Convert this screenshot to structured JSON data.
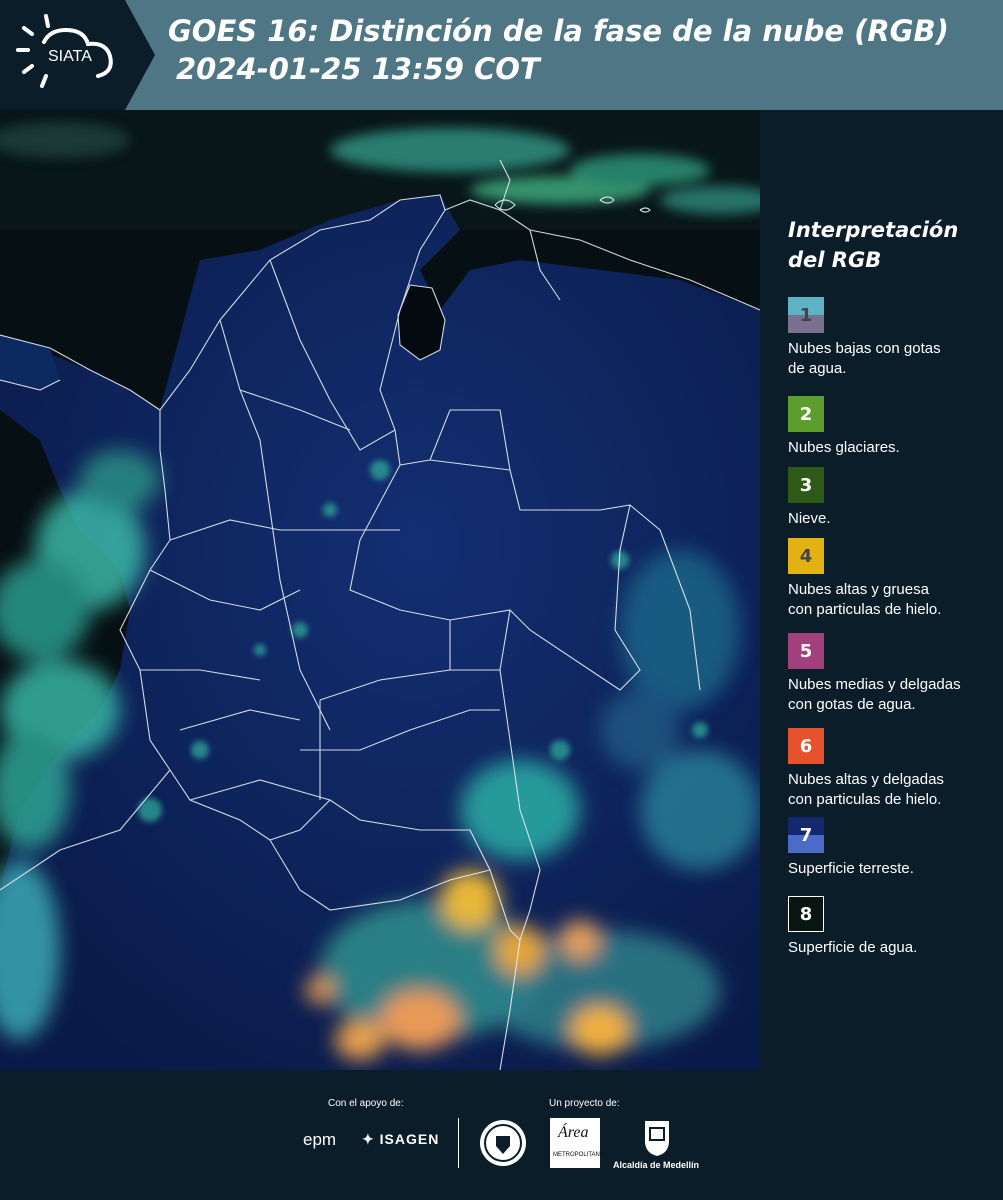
{
  "header": {
    "logo_text": "SIATA",
    "title_line1": "GOES 16: Distinción de la fase de la nube (RGB)",
    "title_line2": "2024-01-25 13:59 COT"
  },
  "map": {
    "icon": "satellite-rgb-map",
    "description_color_land": "#0e2a63",
    "description_color_water": "#06111a"
  },
  "legend": {
    "title_line1": "Interpretación",
    "title_line2": "del RGB",
    "items": [
      {
        "num": "1",
        "text_line1": "Nubes bajas con gotas",
        "text_line2": "de agua.",
        "color_top": "#5cb3c3",
        "color_bottom": "#7a7090",
        "num_color": "#444444"
      },
      {
        "num": "2",
        "text_line1": "Nubes glaciares.",
        "text_line2": "",
        "color_top": "#5c9e2c",
        "color_bottom": "#5c9e2c",
        "num_color": "#ffffff"
      },
      {
        "num": "3",
        "text_line1": "Nieve.",
        "text_line2": "",
        "color_top": "#2e5a17",
        "color_bottom": "#2e5a17",
        "num_color": "#ffffff"
      },
      {
        "num": "4",
        "text_line1": "Nubes altas y gruesa",
        "text_line2": "con particulas de hielo.",
        "color_top": "#e2b212",
        "color_bottom": "#e2b212",
        "num_color": "#444444"
      },
      {
        "num": "5",
        "text_line1": "Nubes medias y delgadas",
        "text_line2": "con gotas de agua.",
        "color_top": "#a2407c",
        "color_bottom": "#a2407c",
        "num_color": "#ffffff"
      },
      {
        "num": "6",
        "text_line1": "Nubes altas y delgadas",
        "text_line2": "con particulas de hielo.",
        "color_top": "#e5512a",
        "color_bottom": "#e5512a",
        "num_color": "#ffffff"
      },
      {
        "num": "7",
        "text_line1": "Superficie terreste.",
        "text_line2": "",
        "color_top": "#15286d",
        "color_bottom": "#4a6bc8",
        "num_color": "#ffffff"
      },
      {
        "num": "8",
        "text_line1": "Superficie de agua.",
        "text_line2": "",
        "color_top": "#081510",
        "color_bottom": "#081510",
        "num_color": "#ffffff"
      }
    ]
  },
  "footer": {
    "support_label": "Con el apoyo de:",
    "project_label": "Un proyecto de:",
    "sponsor1": "epm",
    "sponsor2": "ISAGEN",
    "amva_text": "Área",
    "amva_sub": "METROPOLITANA",
    "medellin": "Alcaldía de Medellín"
  }
}
